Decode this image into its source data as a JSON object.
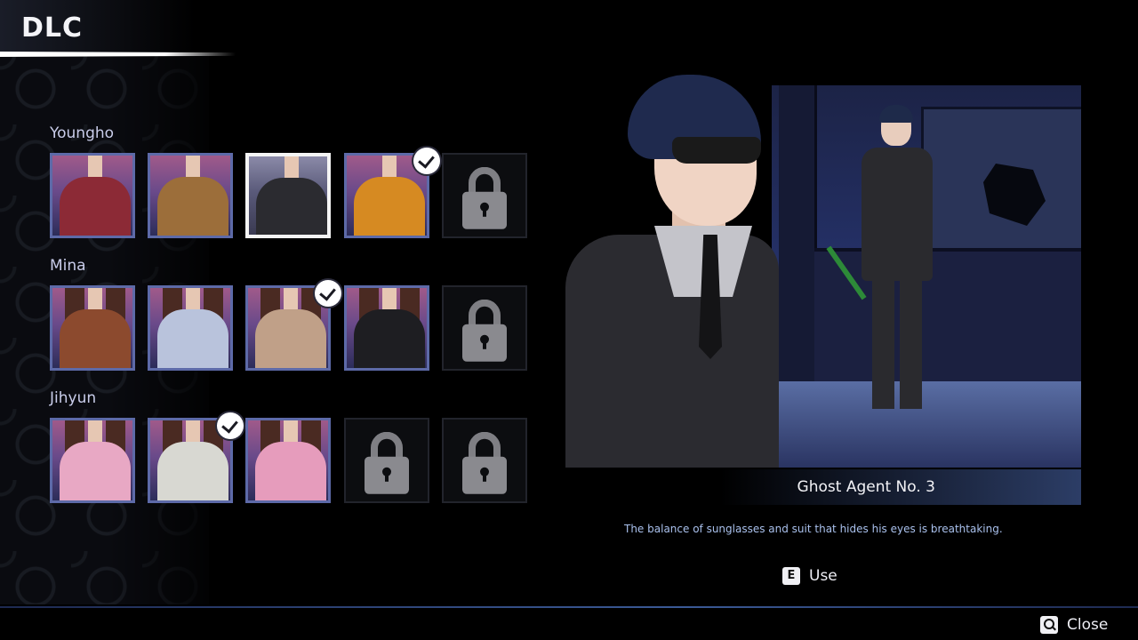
{
  "screen": {
    "title": "DLC"
  },
  "characters": [
    {
      "name": "Youngho",
      "slots": [
        {
          "state": "owned",
          "outfit_color": "#8c2a36",
          "checked": false,
          "selected": false
        },
        {
          "state": "owned",
          "outfit_color": "#9c6e3a",
          "checked": false,
          "selected": false
        },
        {
          "state": "owned",
          "outfit_color": "#2b2b30",
          "checked": false,
          "selected": true
        },
        {
          "state": "owned",
          "outfit_color": "#d68a22",
          "checked": true,
          "selected": false
        },
        {
          "state": "locked"
        }
      ]
    },
    {
      "name": "Mina",
      "slots": [
        {
          "state": "owned",
          "outfit_color": "#8c4a2e",
          "checked": false,
          "selected": false
        },
        {
          "state": "owned",
          "outfit_color": "#b9c3dc",
          "checked": false,
          "selected": false
        },
        {
          "state": "owned",
          "outfit_color": "#c0a088",
          "checked": true,
          "selected": false
        },
        {
          "state": "owned",
          "outfit_color": "#1e1e22",
          "checked": false,
          "selected": false
        },
        {
          "state": "locked"
        }
      ]
    },
    {
      "name": "Jihyun",
      "slots": [
        {
          "state": "owned",
          "outfit_color": "#e8a8c4",
          "checked": false,
          "selected": false
        },
        {
          "state": "owned",
          "outfit_color": "#d8d8d2",
          "checked": true,
          "selected": false
        },
        {
          "state": "owned",
          "outfit_color": "#e69cbc",
          "checked": false,
          "selected": false
        },
        {
          "state": "locked"
        },
        {
          "state": "locked"
        }
      ]
    }
  ],
  "preview": {
    "item_name": "Ghost Agent No. 3",
    "description": "The balance of sunglasses and suit that hides his eyes is breathtaking."
  },
  "actions": {
    "use_key": "E",
    "use_label": "Use",
    "close_label": "Close"
  },
  "colors": {
    "slot_border": "#5d6aa8",
    "selected_border": "#f4f4f4",
    "description_text": "#a9c0ec",
    "name_bar_accent": "#2c3d66"
  }
}
